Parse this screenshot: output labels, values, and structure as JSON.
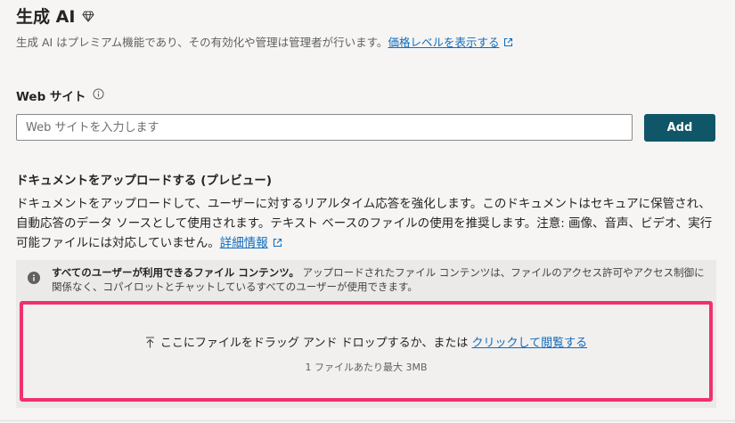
{
  "header": {
    "title": "生成 AI",
    "subtitle_text": "生成 AI はプレミアム機能であり、その有効化や管理は管理者が行います。",
    "pricing_link": "価格レベルを表示する"
  },
  "website": {
    "label": "Web サイト",
    "placeholder": "Web サイトを入力します",
    "add_button": "Add"
  },
  "documents": {
    "title": "ドキュメントをアップロードする (プレビュー)",
    "description": "ドキュメントをアップロードして、ユーザーに対するリアルタイム応答を強化します。このドキュメントはセキュアに保管され、自動応答のデータ ソースとして使用されます。テキスト ベースのファイルの使用を推奨します。注意: 画像、音声、ビデオ、実行可能ファイルには対応していません。",
    "learn_more_link": "詳細情報",
    "notice_bold": "すべてのユーザーが利用できるファイル コンテンツ。",
    "notice_text": " アップロードされたファイル コンテンツは、ファイルのアクセス許可やアクセス制御に関係なく、コパイロットとチャットしているすべてのユーザーが使用できます。",
    "drop_text": "ここにファイルをドラッグ アンド ドロップするか、または ",
    "browse_link": "クリックして閲覧する",
    "size_limit": "1 ファイルあたり最大 3MB"
  },
  "colors": {
    "add_button_bg": "#0f5668",
    "link": "#0f6cbd",
    "dropzone_highlight": "#f0306f"
  }
}
